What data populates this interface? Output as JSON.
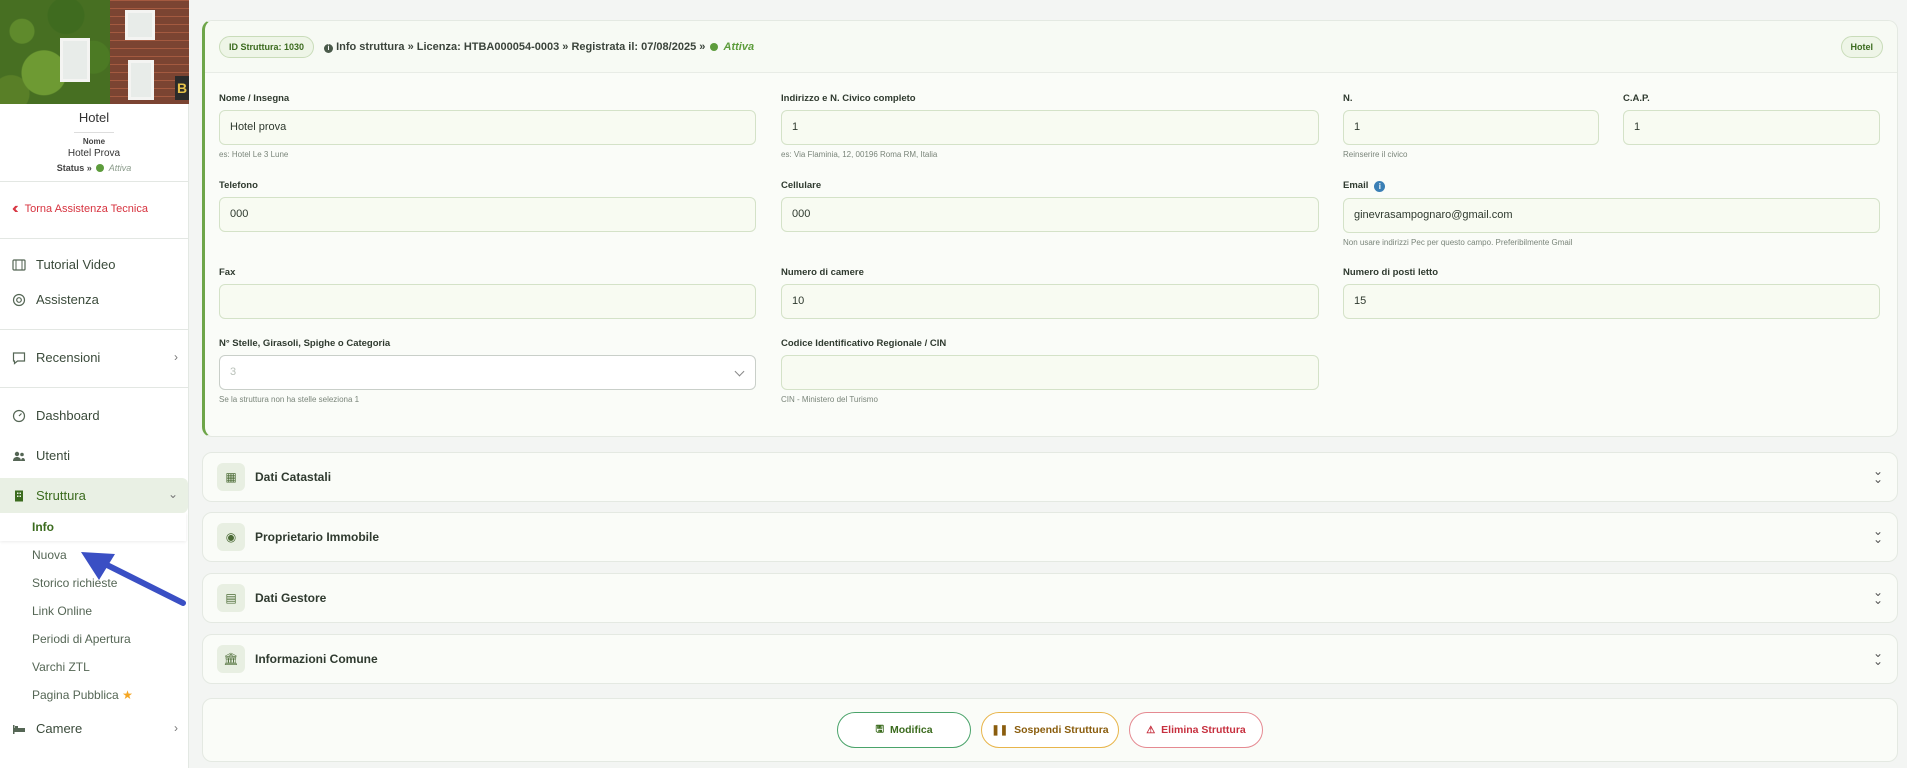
{
  "sidebar": {
    "property_type": "Hotel",
    "name_label": "Nome",
    "name_value": "Hotel Prova",
    "status_label": "Status »",
    "status_value": "Attiva",
    "hero_sign": "B",
    "back_link": "Torna Assistenza Tecnica",
    "items": {
      "tutorial": "Tutorial Video",
      "assistenza": "Assistenza",
      "recensioni": "Recensioni",
      "dashboard": "Dashboard",
      "utenti": "Utenti",
      "struttura": "Struttura",
      "camere": "Camere"
    },
    "subitems": {
      "info": "Info",
      "nuova": "Nuova",
      "storico": "Storico richieste",
      "link": "Link Online",
      "periodi": "Periodi di Apertura",
      "varchi": "Varchi ZTL",
      "pagina": "Pagina Pubblica"
    }
  },
  "header": {
    "id_badge": "ID Struttura: 1030",
    "crumb_text": "Info struttura » Licenza: HTBA000054-0003 » Registrata il: 07/08/2025 »",
    "status": "Attiva",
    "type_badge": "Hotel"
  },
  "form": {
    "nome": {
      "label": "Nome / Insegna",
      "value": "Hotel prova",
      "hint": "es: Hotel Le 3 Lune"
    },
    "indirizzo": {
      "label": "Indirizzo e N. Civico completo",
      "value": "1",
      "hint": "es: Via Flaminia, 12, 00196 Roma RM, Italia"
    },
    "civico": {
      "label": "N.",
      "value": "1",
      "hint": "Reinserire il civico"
    },
    "cap": {
      "label": "C.A.P.",
      "value": "1"
    },
    "telefono": {
      "label": "Telefono",
      "value": "000"
    },
    "cellulare": {
      "label": "Cellulare",
      "value": "000"
    },
    "email": {
      "label": "Email",
      "value": "ginevrasampognaro@gmail.com",
      "hint": "Non usare indirizzi Pec per questo campo. Preferibilmente Gmail"
    },
    "fax": {
      "label": "Fax",
      "value": ""
    },
    "camere": {
      "label": "Numero di camere",
      "value": "10"
    },
    "posti": {
      "label": "Numero di posti letto",
      "value": "15"
    },
    "stelle": {
      "label": "N° Stelle, Girasoli, Spighe o Categoria",
      "value": "3",
      "hint": "Se la struttura non ha stelle seleziona 1"
    },
    "cin": {
      "label": "Codice Identificativo Regionale / CIN",
      "value": "",
      "hint": "CIN - Ministero del Turismo"
    }
  },
  "sections": {
    "catastali": "Dati Catastali",
    "proprietario": "Proprietario Immobile",
    "gestore": "Dati Gestore",
    "comune": "Informazioni Comune"
  },
  "actions": {
    "modifica": "Modifica",
    "sospendi": "Sospendi Struttura",
    "elimina": "Elimina Struttura"
  },
  "colors": {
    "accent": "#5d9c3c",
    "danger": "#d7333f",
    "warning": "#e8b54b",
    "arrow": "#3a4fc4"
  }
}
